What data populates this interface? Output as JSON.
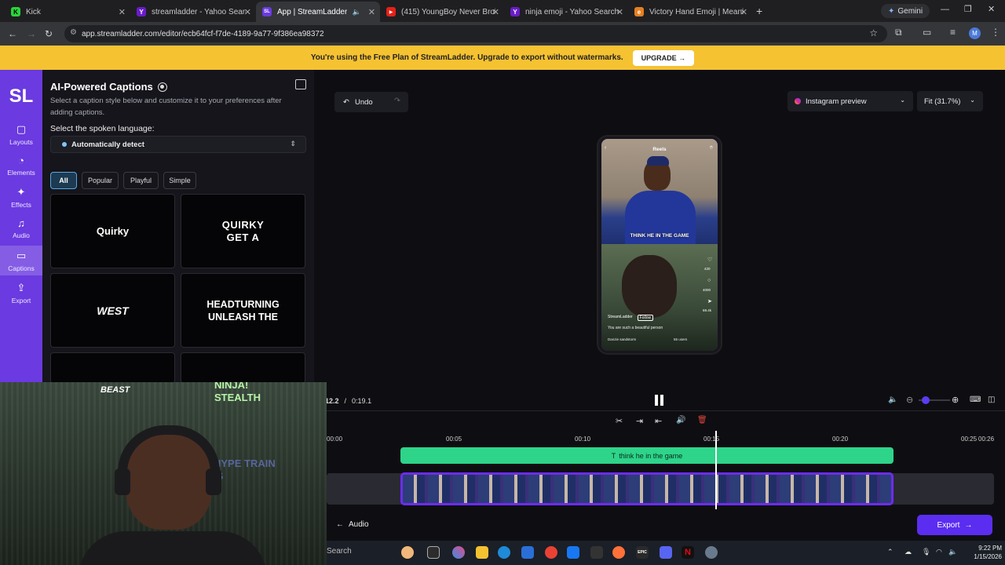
{
  "browser": {
    "tabs": [
      {
        "title": "Kick",
        "icon": "kick-icon"
      },
      {
        "title": "streamladder - Yahoo Search Re",
        "icon": "yahoo-icon"
      },
      {
        "title": "App | StreamLadder",
        "icon": "streamladder-icon"
      },
      {
        "title": "(415) YoungBoy Never Broke A",
        "icon": "youtube-icon"
      },
      {
        "title": "ninja emoji - Yahoo Search Resu",
        "icon": "yahoo-icon"
      },
      {
        "title": "Victory Hand Emoji | Meanin",
        "icon": "emojipedia-icon"
      }
    ],
    "new_tab": "+",
    "gemini_label": "Gemini",
    "url": "app.streamladder.com/editor/ecb64fcf-f7de-4189-9a77-9f386ea98372",
    "profile_initial": "M"
  },
  "banner": {
    "text": "You're using the Free Plan of StreamLadder. Upgrade to export without watermarks.",
    "button": "UPGRADE →"
  },
  "sidebar": {
    "logo": "SL",
    "items": [
      {
        "label": "Layouts",
        "icon": "layouts-icon",
        "glyph": "▢"
      },
      {
        "label": "Elements",
        "icon": "elements-icon",
        "glyph": "◔"
      },
      {
        "label": "Effects",
        "icon": "effects-icon",
        "glyph": "✦"
      },
      {
        "label": "Audio",
        "icon": "music-note-icon",
        "glyph": "♫"
      },
      {
        "label": "Captions",
        "icon": "captions-icon",
        "glyph": "▭"
      },
      {
        "label": "Export",
        "icon": "export-icon",
        "glyph": "⇪"
      }
    ]
  },
  "captions_panel": {
    "title": "AI-Powered Captions",
    "description": "Select a caption style below and customize it to your preferences after adding captions.",
    "language_label": "Select the spoken language:",
    "language_value": "Automatically detect",
    "filters": [
      "All",
      "Popular",
      "Playful",
      "Simple"
    ],
    "styles": [
      "Quirky",
      "QUIRKY GET A",
      "WEST",
      "HEADTURNING UNLEASH THE",
      "BEAST",
      "NINJA! STEALTH"
    ]
  },
  "editor": {
    "undo_label": "Undo",
    "preview_mode": "Instagram preview",
    "fit": "Fit (31.7%)",
    "preview": {
      "header": "Reels",
      "caption": "THINK HE IN THE GAME",
      "account": "StreamLadder",
      "follow": "Follow",
      "comment": "You are such a beautiful person",
      "audio": "Danzie sandstorm",
      "users": "55 users",
      "likes": "420",
      "comments_count": "4000",
      "shares": "69.4k"
    },
    "current_time": "0:12.2",
    "separator": "/",
    "total_time": "0:19.1",
    "ruler": [
      "00:00",
      "00:05",
      "00:10",
      "00:15",
      "00:20",
      "00:25",
      "00:26"
    ],
    "caption_track": "think he in the game",
    "audio_label": "Audio",
    "export_label": "Export"
  },
  "webcam_overlay": {
    "caption_1": "BEAST",
    "caption_2": "NINJA! STEALTH",
    "caption_3": "HYPE TRAIN IS"
  },
  "taskbar": {
    "search": "Search",
    "time": "9:22 PM",
    "date": "1/15/2026"
  },
  "colors": {
    "accent": "#6b3ae0",
    "banner": "#f5c232",
    "caption_track": "#2dd48a",
    "video_track": "#6d2cf0"
  }
}
